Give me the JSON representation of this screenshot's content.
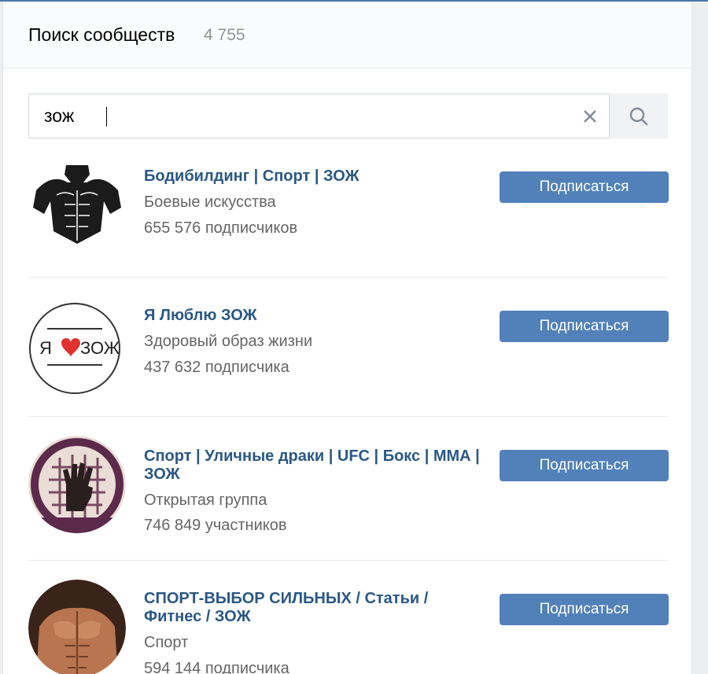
{
  "header": {
    "title": "Поиск сообществ",
    "count": "4 755"
  },
  "search": {
    "value": "зож",
    "placeholder": "",
    "clear_icon": "close-icon",
    "search_icon": "search-icon"
  },
  "results": [
    {
      "name": "Бодибилдинг | Спорт | ЗОЖ",
      "category": "Боевые искусства",
      "members": "655 576 подписчиков",
      "button": "Подписаться",
      "avatar": "bodybuilder-silhouette"
    },
    {
      "name": "Я Люблю ЗОЖ",
      "category": "Здоровый образ жизни",
      "members": "437 632 подписчика",
      "button": "Подписаться",
      "avatar": "heart-logo",
      "avatar_text_left": "Я",
      "avatar_text_right": "ЗОЖ"
    },
    {
      "name": "Спорт | Уличные драки | UFC | Бокс | ММА | ЗОЖ",
      "category": "Открытая группа",
      "members": "746 849 участников",
      "button": "Подписаться",
      "avatar": "fist-cage-logo"
    },
    {
      "name": "СПОРТ-ВЫБОР СИЛЬНЫХ / Статьи / Фитнес / ЗОЖ",
      "category": "Спорт",
      "members": "594 144 подписчика",
      "button": "Подписаться",
      "avatar": "muscular-torso-photo"
    }
  ],
  "colors": {
    "link": "#2a5885",
    "button": "#5181b8",
    "muted": "#656565",
    "heart": "#e0322f"
  }
}
